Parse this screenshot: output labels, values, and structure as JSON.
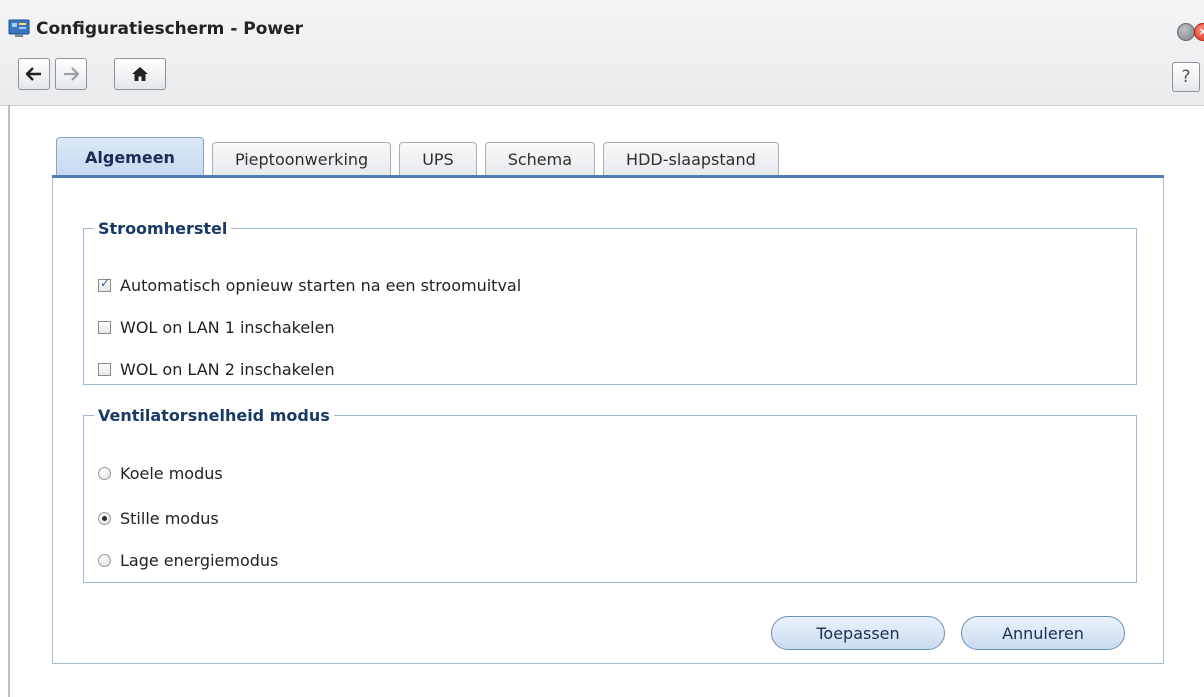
{
  "window": {
    "title": "Configuratiescherm - Power",
    "icons": {
      "app": "control-panel-icon",
      "minimize": "minimize-icon",
      "close": "close-icon"
    }
  },
  "toolbar": {
    "back_icon": "arrow-left-icon",
    "forward_icon": "arrow-right-icon",
    "home_icon": "home-icon",
    "help_label": "?"
  },
  "tabs": [
    {
      "label": "Algemeen",
      "active": true
    },
    {
      "label": "Pieptoonwerking",
      "active": false
    },
    {
      "label": "UPS",
      "active": false
    },
    {
      "label": "Schema",
      "active": false
    },
    {
      "label": "HDD-slaapstand",
      "active": false
    }
  ],
  "power_recovery": {
    "legend": "Stroomherstel",
    "options": [
      {
        "label": "Automatisch opnieuw starten na een stroomuitval",
        "checked": true
      },
      {
        "label": "WOL on LAN 1 inschakelen",
        "checked": false
      },
      {
        "label": "WOL on LAN 2 inschakelen",
        "checked": false
      }
    ]
  },
  "fan_mode": {
    "legend": "Ventilatorsnelheid modus",
    "options": [
      {
        "label": "Koele modus",
        "selected": false
      },
      {
        "label": "Stille modus",
        "selected": true
      },
      {
        "label": "Lage energiemodus",
        "selected": false
      }
    ]
  },
  "actions": {
    "apply_label": "Toepassen",
    "cancel_label": "Annuleren"
  },
  "colors": {
    "accent": "#4e7eb3",
    "legend_text": "#1a3a66",
    "close_button": "#d2301b"
  }
}
